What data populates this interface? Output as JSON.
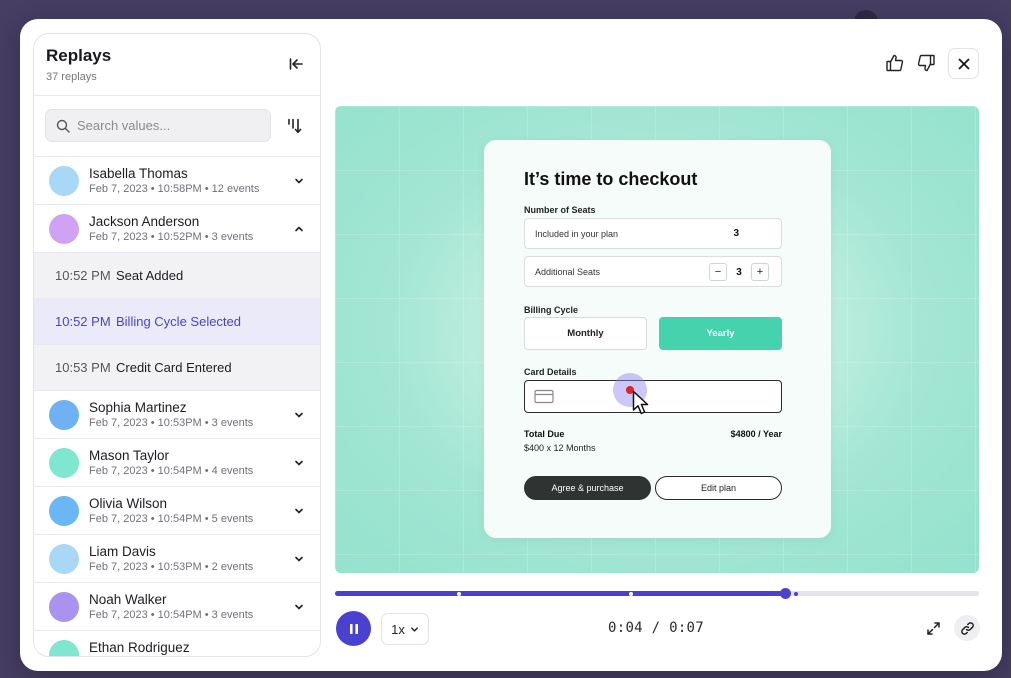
{
  "sidebar": {
    "title": "Replays",
    "count": "37 replays",
    "search_placeholder": "Search values...",
    "users": [
      {
        "name": "Isabella Thomas",
        "meta": "Feb 7, 2023 • 10:58PM • 12 events",
        "color": "#a9d8f7",
        "expanded": false
      },
      {
        "name": "Jackson Anderson",
        "meta": "Feb 7, 2023 • 10:52PM • 3 events",
        "color": "#cfa2f3",
        "expanded": true,
        "events": [
          {
            "time": "10:52 PM",
            "label": "Seat Added",
            "active": false
          },
          {
            "time": "10:52 PM",
            "label": "Billing Cycle Selected",
            "active": true
          },
          {
            "time": "10:53 PM",
            "label": "Credit Card Entered",
            "active": false
          }
        ]
      },
      {
        "name": "Sophia Martinez",
        "meta": "Feb 7, 2023 • 10:53PM • 3 events",
        "color": "#6fb1f2",
        "expanded": false
      },
      {
        "name": "Mason Taylor",
        "meta": "Feb 7, 2023 • 10:54PM • 4 events",
        "color": "#7fe7cf",
        "expanded": false
      },
      {
        "name": "Olivia Wilson",
        "meta": "Feb 7, 2023 • 10:54PM • 5 events",
        "color": "#6bb6f5",
        "expanded": false
      },
      {
        "name": "Liam Davis",
        "meta": "Feb 7, 2023 • 10:53PM • 2 events",
        "color": "#a9d8f7",
        "expanded": false
      },
      {
        "name": "Noah Walker",
        "meta": "Feb 7, 2023 • 10:54PM • 3 events",
        "color": "#a993ef",
        "expanded": false
      },
      {
        "name": "Ethan Rodriguez",
        "meta": "",
        "color": "#7fe7cf",
        "expanded": false
      }
    ]
  },
  "checkout": {
    "title": "It’s time to checkout",
    "seats_label": "Number of Seats",
    "included_label": "Included in your plan",
    "included_value": "3",
    "additional_label": "Additional Seats",
    "additional_value": "3",
    "minus": "−",
    "plus": "+",
    "billing_label": "Billing Cycle",
    "monthly": "Monthly",
    "yearly": "Yearly",
    "card_label": "Card Details",
    "total_label": "Total Due",
    "total_sub": "$400 x 12 Months",
    "total_value": "$4800 / Year",
    "agree_button": "Agree & purchase",
    "edit_button": "Edit plan"
  },
  "player": {
    "progress": 0.7,
    "markers": [
      0.19,
      0.457,
      0.713
    ],
    "after_marker": 0.71,
    "speed": "1x",
    "time_display": "0:04 / 0:07",
    "accent": "#4a42cf"
  }
}
